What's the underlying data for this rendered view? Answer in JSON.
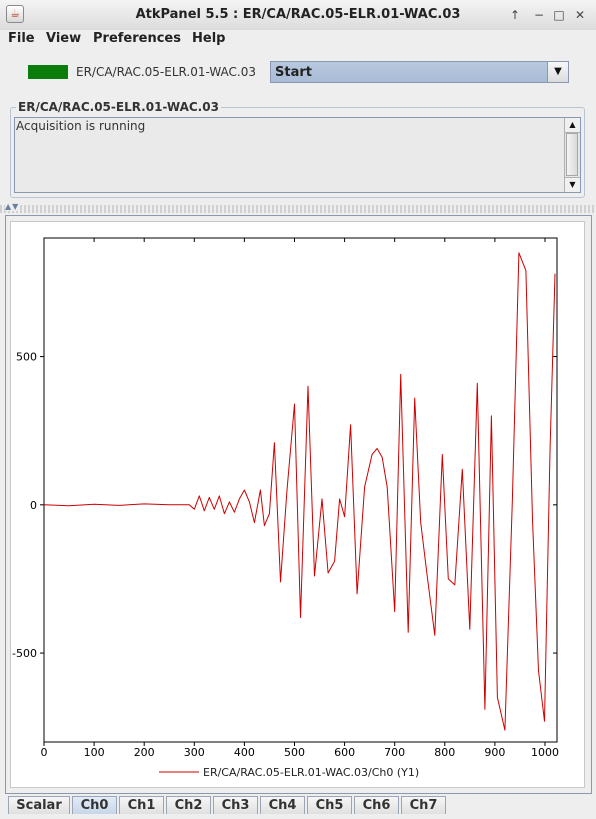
{
  "window": {
    "title": "AtkPanel  5.5  : ER/CA/RAC.05-ELR.01-WAC.03",
    "app_icon": "java-icon",
    "controls": [
      "↑",
      "−",
      "□",
      "✕"
    ]
  },
  "menu": {
    "items": [
      "File",
      "View",
      "Preferences",
      "Help"
    ]
  },
  "device": {
    "name": "ER/CA/RAC.05-ELR.01-WAC.03",
    "state_color": "#0a7d0a",
    "command": "Start"
  },
  "status": {
    "title": "ER/CA/RAC.05-ELR.01-WAC.03",
    "text": "Acquisition is running"
  },
  "tabs": {
    "items": [
      "Scalar",
      "Ch0",
      "Ch1",
      "Ch2",
      "Ch3",
      "Ch4",
      "Ch5",
      "Ch6",
      "Ch7"
    ],
    "active": "Ch0"
  },
  "chart_data": {
    "type": "line",
    "title": "",
    "xlabel": "",
    "ylabel": "",
    "xlim": [
      0,
      1024
    ],
    "ylim": [
      -800,
      900
    ],
    "xticks": [
      0,
      100,
      200,
      300,
      400,
      500,
      600,
      700,
      800,
      900,
      1000
    ],
    "yticks": [
      -500,
      0,
      500
    ],
    "grid": false,
    "legend": "bottom",
    "series": [
      {
        "name": "ER/CA/RAC.05-ELR.01-WAC.03/Ch0 (Y1)",
        "color": "#cc0000",
        "x": [
          0,
          50,
          100,
          150,
          200,
          250,
          290,
          300,
          310,
          320,
          330,
          340,
          350,
          360,
          370,
          380,
          390,
          400,
          410,
          420,
          432,
          440,
          450,
          460,
          472,
          485,
          500,
          512,
          527,
          540,
          555,
          567,
          580,
          590,
          600,
          612,
          625,
          640,
          655,
          665,
          675,
          685,
          700,
          712,
          727,
          740,
          752,
          765,
          780,
          795,
          807,
          820,
          835,
          850,
          865,
          880,
          893,
          905,
          920,
          935,
          948,
          962,
          975,
          987,
          999,
          1010,
          1020
        ],
        "y": [
          0,
          -3,
          2,
          -2,
          3,
          0,
          0,
          -15,
          30,
          -20,
          25,
          -15,
          30,
          -30,
          10,
          -25,
          20,
          50,
          10,
          -60,
          50,
          -70,
          -30,
          210,
          -260,
          50,
          340,
          -380,
          400,
          -240,
          20,
          -230,
          -190,
          20,
          -40,
          270,
          -300,
          60,
          170,
          190,
          160,
          60,
          -360,
          440,
          -430,
          360,
          -60,
          -240,
          -440,
          170,
          -250,
          -270,
          120,
          -420,
          410,
          -690,
          300,
          -650,
          -760,
          20,
          850,
          790,
          -50,
          -560,
          -730,
          180,
          780
        ]
      }
    ]
  }
}
